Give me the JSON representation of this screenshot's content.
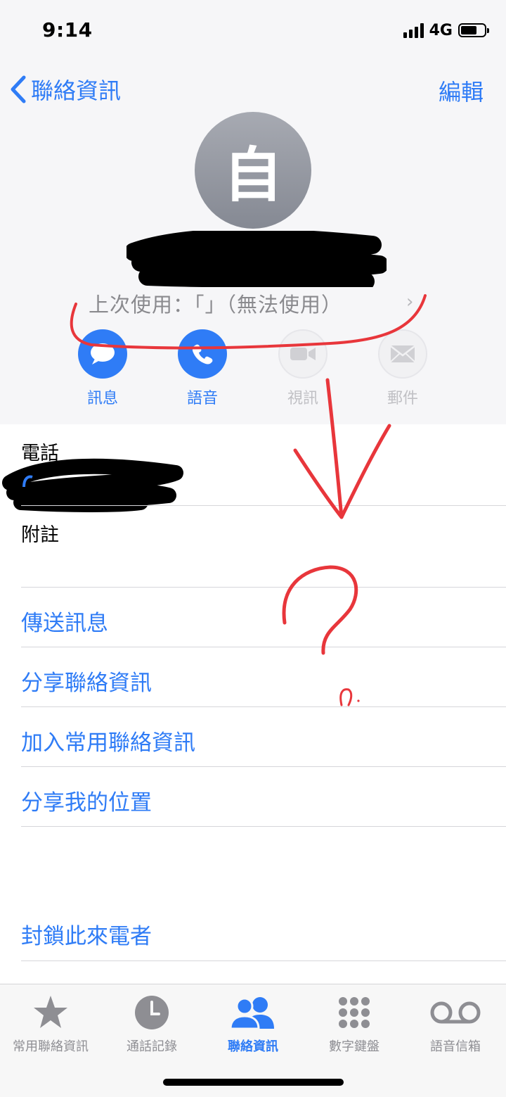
{
  "status_bar": {
    "time": "9:14",
    "network": "4G"
  },
  "nav": {
    "back_label": "聯絡資訊",
    "edit_label": "編輯"
  },
  "contact": {
    "avatar_initial": "自",
    "last_used": "上次使用：「」（無法使用）"
  },
  "actions": [
    {
      "label": "訊息",
      "icon": "message-bubble-icon",
      "enabled": true
    },
    {
      "label": "語音",
      "icon": "phone-icon",
      "enabled": true
    },
    {
      "label": "視訊",
      "icon": "video-camera-icon",
      "enabled": false
    },
    {
      "label": "郵件",
      "icon": "envelope-icon",
      "enabled": false
    }
  ],
  "fields": {
    "phone_label": "電話",
    "notes_label": "附註"
  },
  "links": {
    "send_message": "傳送訊息",
    "share_contact": "分享聯絡資訊",
    "add_favorite": "加入常用聯絡資訊",
    "share_location": "分享我的位置",
    "block_caller": "封鎖此來電者"
  },
  "tabs": [
    {
      "label": "常用聯絡資訊",
      "icon": "star-icon",
      "active": false
    },
    {
      "label": "通話記錄",
      "icon": "clock-icon",
      "active": false
    },
    {
      "label": "聯絡資訊",
      "icon": "contacts-people-icon",
      "active": true
    },
    {
      "label": "數字鍵盤",
      "icon": "keypad-icon",
      "active": false
    },
    {
      "label": "語音信箱",
      "icon": "voicemail-icon",
      "active": false
    }
  ],
  "colors": {
    "accent": "#2f7cf6",
    "annotation_red": "#e8363b",
    "redaction": "#000000"
  }
}
